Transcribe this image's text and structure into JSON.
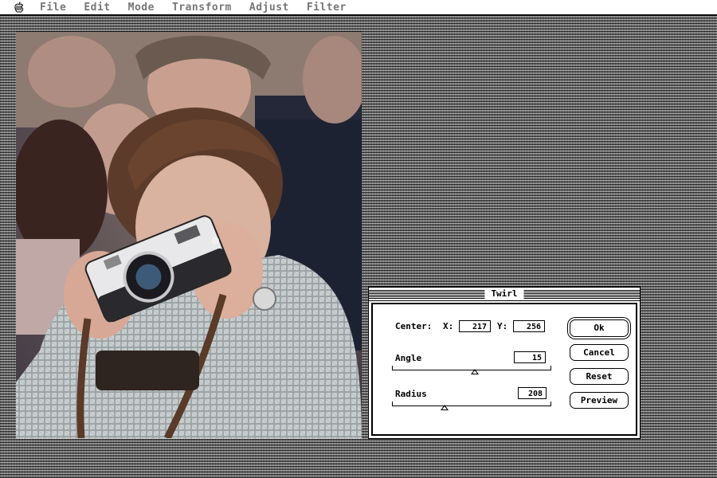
{
  "menubar": {
    "apple_icon": "apple-icon",
    "items": [
      "File",
      "Edit",
      "Mode",
      "Transform",
      "Adjust",
      "Filter"
    ]
  },
  "canvas": {
    "description_icon": "photo-canvas"
  },
  "dialog": {
    "title": "Twirl",
    "center_label": "Center:",
    "x_label": "X:",
    "x_value": "217",
    "y_label": "Y:",
    "y_value": "256",
    "angle_label": "Angle",
    "angle_value": "15",
    "angle_slider_fraction": 0.52,
    "radius_label": "Radius",
    "radius_value": "208",
    "radius_slider_fraction": 0.33,
    "buttons": {
      "ok": "Ok",
      "cancel": "Cancel",
      "reset": "Reset",
      "preview": "Preview"
    }
  }
}
